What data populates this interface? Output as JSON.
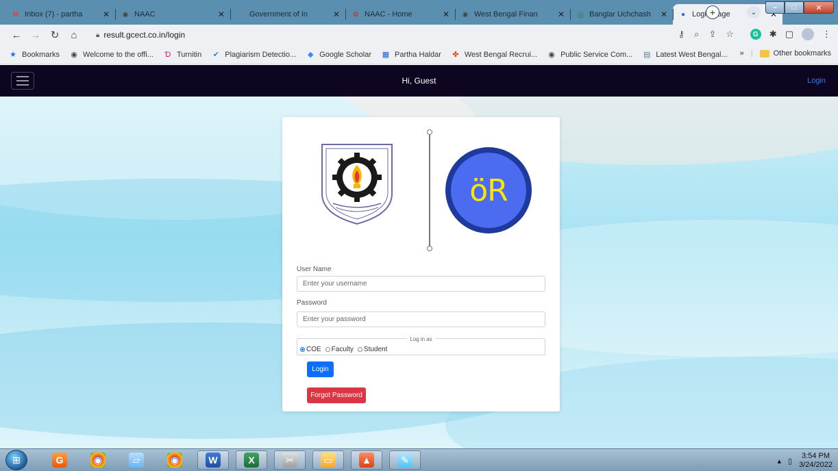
{
  "browser": {
    "tabs": [
      {
        "title": "Inbox (7) - partha",
        "icon": "gmail-icon",
        "glyph": "M",
        "color": "#d44638"
      },
      {
        "title": "NAAC",
        "icon": "globe-icon",
        "glyph": "◉",
        "color": "#444"
      },
      {
        "title": "Government of In",
        "icon": "emblem-icon",
        "glyph": "◌",
        "color": "#777"
      },
      {
        "title": "NAAC - Home",
        "icon": "naac-icon",
        "glyph": "✿",
        "color": "#c0392b"
      },
      {
        "title": "West Bengal Finan",
        "icon": "globe-icon",
        "glyph": "◉",
        "color": "#444"
      },
      {
        "title": "Banglar Uchchash",
        "icon": "bangla-icon",
        "glyph": "ⓑ",
        "color": "#2e8b57"
      },
      {
        "title": "Login Page",
        "icon": "login-favicon",
        "glyph": "●",
        "color": "#3b5bdb",
        "active": true
      }
    ],
    "url": "result.gcect.co.in/login",
    "bookmarks": [
      {
        "label": "Bookmarks",
        "icon": "star-icon",
        "glyph": "★",
        "color": "#1a73e8"
      },
      {
        "label": "Welcome to the offi...",
        "icon": "globe-icon",
        "glyph": "◉",
        "color": "#444"
      },
      {
        "label": "Turnitin",
        "icon": "turnitin-icon",
        "glyph": "Ɗ",
        "color": "#c2185b"
      },
      {
        "label": "Plagiarism Detectio...",
        "icon": "check-icon",
        "glyph": "✔",
        "color": "#1e88e5"
      },
      {
        "label": "Google Scholar",
        "icon": "scholar-icon",
        "glyph": "◆",
        "color": "#4285f4"
      },
      {
        "label": "Partha Haldar",
        "icon": "calendar-icon",
        "glyph": "▦",
        "color": "#1565c0"
      },
      {
        "label": "West Bengal Recrui...",
        "icon": "wb-icon",
        "glyph": "✤",
        "color": "#d84315"
      },
      {
        "label": "Public Service Com...",
        "icon": "globe-icon",
        "glyph": "◉",
        "color": "#444"
      },
      {
        "label": "Latest West Bengal...",
        "icon": "news-icon",
        "glyph": "▤",
        "color": "#607d8b"
      }
    ],
    "more_bookmarks": "»",
    "other_bookmarks": "Other bookmarks"
  },
  "navbar": {
    "greeting": "Hi,  Guest",
    "login_link": "Login"
  },
  "form": {
    "username_label": "User Name",
    "username_placeholder": "Enter your username",
    "password_label": "Password",
    "password_placeholder": "Enter your password",
    "login_as_legend": "Log in as",
    "roles": [
      {
        "label": "COE",
        "selected": true
      },
      {
        "label": "Faculty",
        "selected": false
      },
      {
        "label": "Student",
        "selected": false
      }
    ],
    "login_button": "Login",
    "forgot_button": "Forgot Password",
    "logo_text": "öR"
  },
  "taskbar": {
    "apps": [
      "internet-explorer-icon",
      "pdf-reader-icon",
      "chrome-icon",
      "notepad-icon",
      "chrome-icon",
      "word-icon",
      "excel-icon",
      "snipping-tool-icon",
      "file-explorer-icon",
      "matlab-icon",
      "paint-icon"
    ],
    "time": "3:54 PM",
    "date": "3/24/2022"
  },
  "colors": {
    "navbar_bg": "#0e0620",
    "login_link": "#2c7cf6",
    "login_button": "#0d6efd",
    "forgot_button": "#dc3545",
    "logo_circle": "#4b6cf0",
    "logo_text": "#ffe600"
  }
}
